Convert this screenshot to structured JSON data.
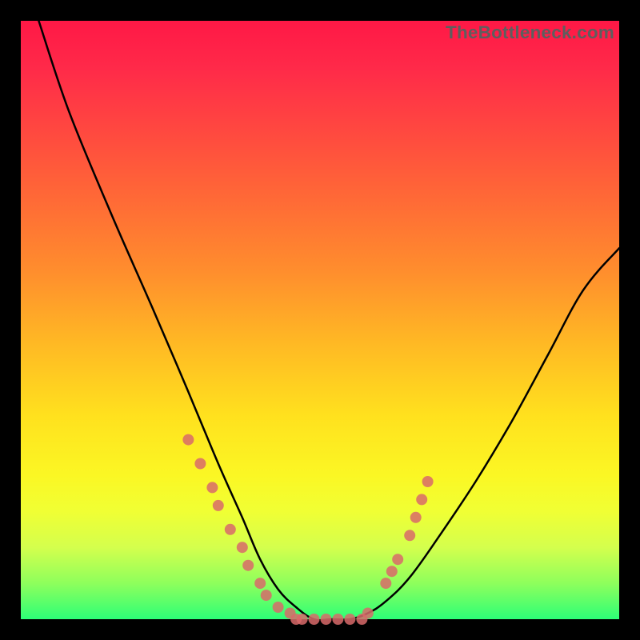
{
  "watermark": "TheBottleneck.com",
  "chart_data": {
    "type": "line",
    "title": "",
    "xlabel": "",
    "ylabel": "",
    "xlim": [
      0,
      100
    ],
    "ylim": [
      0,
      100
    ],
    "grid": false,
    "legend": false,
    "series": [
      {
        "name": "bottleneck-curve",
        "color": "#000000",
        "x": [
          3,
          8,
          15,
          22,
          28,
          33,
          37,
          40,
          43,
          46,
          49,
          52,
          55,
          58,
          61,
          65,
          70,
          76,
          82,
          88,
          94,
          100
        ],
        "y": [
          100,
          85,
          68,
          52,
          38,
          26,
          17,
          10,
          5,
          2,
          0,
          0,
          0,
          1,
          3,
          7,
          14,
          23,
          33,
          44,
          55,
          62
        ]
      },
      {
        "name": "markers-left",
        "type": "scatter",
        "color": "#d86a6a",
        "x": [
          28,
          30,
          32,
          33,
          35,
          37,
          38,
          40,
          41,
          43,
          45,
          46
        ],
        "y": [
          30,
          26,
          22,
          19,
          15,
          12,
          9,
          6,
          4,
          2,
          1,
          0
        ]
      },
      {
        "name": "markers-bottom",
        "type": "scatter",
        "color": "#d86a6a",
        "x": [
          47,
          49,
          51,
          53,
          55,
          57,
          58
        ],
        "y": [
          0,
          0,
          0,
          0,
          0,
          0,
          1
        ]
      },
      {
        "name": "markers-right",
        "type": "scatter",
        "color": "#d86a6a",
        "x": [
          61,
          62,
          63,
          65,
          66,
          67,
          68
        ],
        "y": [
          6,
          8,
          10,
          14,
          17,
          20,
          23
        ]
      }
    ],
    "annotations": []
  }
}
